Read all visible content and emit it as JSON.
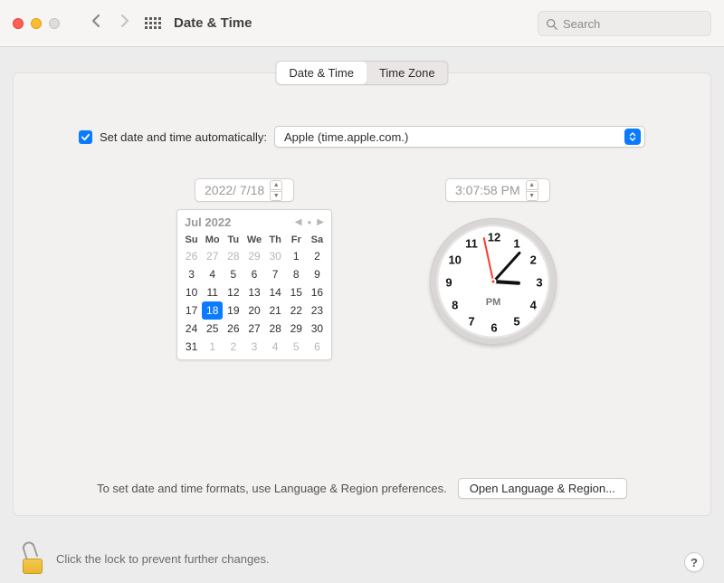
{
  "window": {
    "title": "Date & Time"
  },
  "search": {
    "placeholder": "Search"
  },
  "tabs": {
    "dateTime": "Date & Time",
    "timeZone": "Time Zone",
    "active": 0
  },
  "auto": {
    "checked": true,
    "label": "Set date and time automatically:",
    "serverOption": "Apple (time.apple.com.)"
  },
  "dateField": "2022/  7/18",
  "timeField": "3:07:58 PM",
  "calendar": {
    "title": "Jul 2022",
    "dow": [
      "Su",
      "Mo",
      "Tu",
      "We",
      "Th",
      "Fr",
      "Sa"
    ],
    "leading": [
      26,
      27,
      28,
      29,
      30
    ],
    "days": [
      1,
      2,
      3,
      4,
      5,
      6,
      7,
      8,
      9,
      10,
      11,
      12,
      13,
      14,
      15,
      16,
      17,
      18,
      19,
      20,
      21,
      22,
      23,
      24,
      25,
      26,
      27,
      28,
      29,
      30,
      31
    ],
    "trailing": [
      1,
      2,
      3,
      4,
      5,
      6
    ],
    "selected": 18
  },
  "clock": {
    "ampm": "PM",
    "hour": 3,
    "minute": 7,
    "second": 58
  },
  "footer": {
    "note": "To set date and time formats, use Language & Region preferences.",
    "button": "Open Language & Region..."
  },
  "lock": {
    "text": "Click the lock to prevent further changes."
  },
  "help": {
    "label": "?"
  }
}
